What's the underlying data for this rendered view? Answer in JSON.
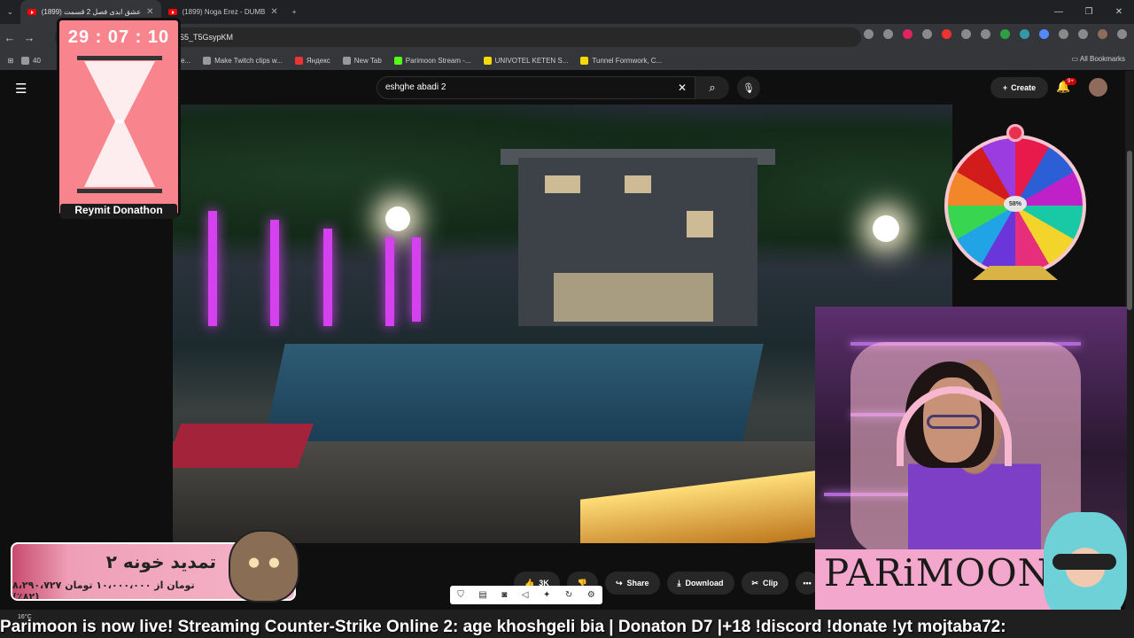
{
  "browser": {
    "tabs": [
      {
        "label": "(1899) عشق ابدی فصل 2 قسمت",
        "active": true
      },
      {
        "label": "(1899) Noga Erez - DUMB",
        "active": false
      }
    ],
    "url_fragment": "S5_T5GsypKM",
    "new_tab_symbol": "+",
    "bookmarks": [
      {
        "label": "40",
        "icon": "globe-icon"
      },
      {
        "label": "e We...",
        "icon": "page-icon"
      },
      {
        "label": "Make Twitch clips w...",
        "icon": "triangle-icon"
      },
      {
        "label": "Яндекс",
        "icon": "yandex-icon"
      },
      {
        "label": "New Tab",
        "icon": "globe-icon"
      },
      {
        "label": "Parimoon Stream -...",
        "icon": "kick-icon"
      },
      {
        "label": "UNIVOTEL KETEN S...",
        "icon": "s-icon"
      },
      {
        "label": "Tunnel Formwork, C...",
        "icon": "s-icon"
      }
    ],
    "all_bookmarks": "All Bookmarks"
  },
  "youtube": {
    "search_value": "eshghe abadi 2",
    "create_label": "Create",
    "notif_badge": "9+",
    "actions": {
      "likes": "3K",
      "share": "Share",
      "download": "Download",
      "clip": "Clip",
      "more": "•••"
    }
  },
  "stream_overlay": {
    "timer": "29 : 07 : 10",
    "timer_label": "Reymit Donathon",
    "wheel_center": "58%",
    "brand": "PARiMOON",
    "extend_title": "تمدید خونه ۲",
    "extend_sub": "۸،۲۹۰،۷۲۷ تومان از ۱۰،۰۰۰،۰۰۰ تومان (۸۲٪)",
    "ticker": "Parimoon is now live! Streaming Counter-Strike Online 2: age khoshgeli bia | Donaton D7 |+18 !discord  !donate !yt mojtaba72:",
    "weather": "16°C"
  }
}
